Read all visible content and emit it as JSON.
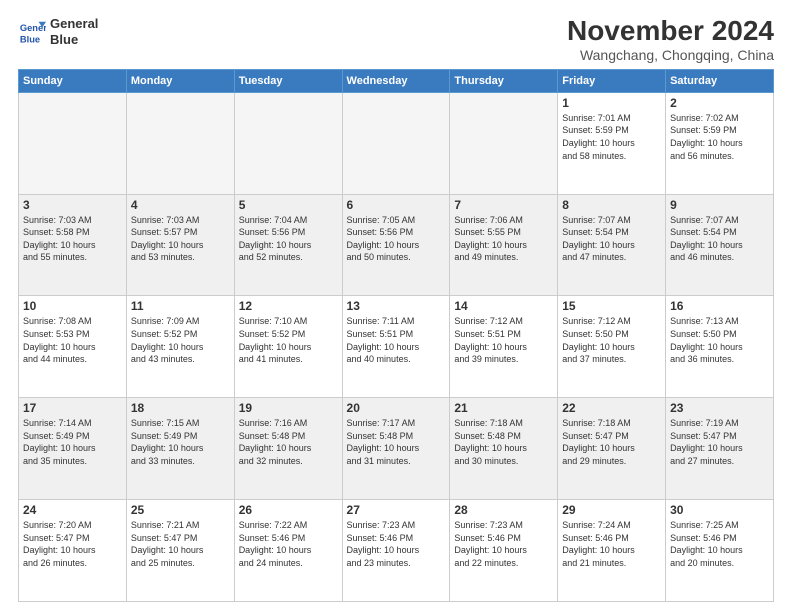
{
  "header": {
    "logo_line1": "General",
    "logo_line2": "Blue",
    "month": "November 2024",
    "location": "Wangchang, Chongqing, China"
  },
  "weekdays": [
    "Sunday",
    "Monday",
    "Tuesday",
    "Wednesday",
    "Thursday",
    "Friday",
    "Saturday"
  ],
  "weeks": [
    [
      {
        "day": "",
        "info": ""
      },
      {
        "day": "",
        "info": ""
      },
      {
        "day": "",
        "info": ""
      },
      {
        "day": "",
        "info": ""
      },
      {
        "day": "",
        "info": ""
      },
      {
        "day": "1",
        "info": "Sunrise: 7:01 AM\nSunset: 5:59 PM\nDaylight: 10 hours\nand 58 minutes."
      },
      {
        "day": "2",
        "info": "Sunrise: 7:02 AM\nSunset: 5:59 PM\nDaylight: 10 hours\nand 56 minutes."
      }
    ],
    [
      {
        "day": "3",
        "info": "Sunrise: 7:03 AM\nSunset: 5:58 PM\nDaylight: 10 hours\nand 55 minutes."
      },
      {
        "day": "4",
        "info": "Sunrise: 7:03 AM\nSunset: 5:57 PM\nDaylight: 10 hours\nand 53 minutes."
      },
      {
        "day": "5",
        "info": "Sunrise: 7:04 AM\nSunset: 5:56 PM\nDaylight: 10 hours\nand 52 minutes."
      },
      {
        "day": "6",
        "info": "Sunrise: 7:05 AM\nSunset: 5:56 PM\nDaylight: 10 hours\nand 50 minutes."
      },
      {
        "day": "7",
        "info": "Sunrise: 7:06 AM\nSunset: 5:55 PM\nDaylight: 10 hours\nand 49 minutes."
      },
      {
        "day": "8",
        "info": "Sunrise: 7:07 AM\nSunset: 5:54 PM\nDaylight: 10 hours\nand 47 minutes."
      },
      {
        "day": "9",
        "info": "Sunrise: 7:07 AM\nSunset: 5:54 PM\nDaylight: 10 hours\nand 46 minutes."
      }
    ],
    [
      {
        "day": "10",
        "info": "Sunrise: 7:08 AM\nSunset: 5:53 PM\nDaylight: 10 hours\nand 44 minutes."
      },
      {
        "day": "11",
        "info": "Sunrise: 7:09 AM\nSunset: 5:52 PM\nDaylight: 10 hours\nand 43 minutes."
      },
      {
        "day": "12",
        "info": "Sunrise: 7:10 AM\nSunset: 5:52 PM\nDaylight: 10 hours\nand 41 minutes."
      },
      {
        "day": "13",
        "info": "Sunrise: 7:11 AM\nSunset: 5:51 PM\nDaylight: 10 hours\nand 40 minutes."
      },
      {
        "day": "14",
        "info": "Sunrise: 7:12 AM\nSunset: 5:51 PM\nDaylight: 10 hours\nand 39 minutes."
      },
      {
        "day": "15",
        "info": "Sunrise: 7:12 AM\nSunset: 5:50 PM\nDaylight: 10 hours\nand 37 minutes."
      },
      {
        "day": "16",
        "info": "Sunrise: 7:13 AM\nSunset: 5:50 PM\nDaylight: 10 hours\nand 36 minutes."
      }
    ],
    [
      {
        "day": "17",
        "info": "Sunrise: 7:14 AM\nSunset: 5:49 PM\nDaylight: 10 hours\nand 35 minutes."
      },
      {
        "day": "18",
        "info": "Sunrise: 7:15 AM\nSunset: 5:49 PM\nDaylight: 10 hours\nand 33 minutes."
      },
      {
        "day": "19",
        "info": "Sunrise: 7:16 AM\nSunset: 5:48 PM\nDaylight: 10 hours\nand 32 minutes."
      },
      {
        "day": "20",
        "info": "Sunrise: 7:17 AM\nSunset: 5:48 PM\nDaylight: 10 hours\nand 31 minutes."
      },
      {
        "day": "21",
        "info": "Sunrise: 7:18 AM\nSunset: 5:48 PM\nDaylight: 10 hours\nand 30 minutes."
      },
      {
        "day": "22",
        "info": "Sunrise: 7:18 AM\nSunset: 5:47 PM\nDaylight: 10 hours\nand 29 minutes."
      },
      {
        "day": "23",
        "info": "Sunrise: 7:19 AM\nSunset: 5:47 PM\nDaylight: 10 hours\nand 27 minutes."
      }
    ],
    [
      {
        "day": "24",
        "info": "Sunrise: 7:20 AM\nSunset: 5:47 PM\nDaylight: 10 hours\nand 26 minutes."
      },
      {
        "day": "25",
        "info": "Sunrise: 7:21 AM\nSunset: 5:47 PM\nDaylight: 10 hours\nand 25 minutes."
      },
      {
        "day": "26",
        "info": "Sunrise: 7:22 AM\nSunset: 5:46 PM\nDaylight: 10 hours\nand 24 minutes."
      },
      {
        "day": "27",
        "info": "Sunrise: 7:23 AM\nSunset: 5:46 PM\nDaylight: 10 hours\nand 23 minutes."
      },
      {
        "day": "28",
        "info": "Sunrise: 7:23 AM\nSunset: 5:46 PM\nDaylight: 10 hours\nand 22 minutes."
      },
      {
        "day": "29",
        "info": "Sunrise: 7:24 AM\nSunset: 5:46 PM\nDaylight: 10 hours\nand 21 minutes."
      },
      {
        "day": "30",
        "info": "Sunrise: 7:25 AM\nSunset: 5:46 PM\nDaylight: 10 hours\nand 20 minutes."
      }
    ]
  ]
}
